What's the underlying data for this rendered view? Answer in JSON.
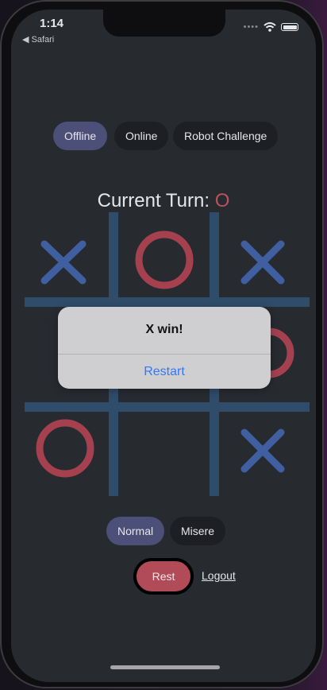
{
  "status_bar": {
    "time": "1:14",
    "back_label": "◀ Safari"
  },
  "mode_tabs": [
    {
      "label": "Offline",
      "active": true
    },
    {
      "label": "Online",
      "active": false
    },
    {
      "label": "Robot Challenge",
      "active": false
    }
  ],
  "turn": {
    "label": "Current Turn:",
    "mark": "O"
  },
  "board": {
    "cells": [
      "X",
      "O",
      "X",
      "",
      "",
      "O",
      "O",
      "",
      "X"
    ]
  },
  "variant_tabs": [
    {
      "label": "Normal",
      "active": true
    },
    {
      "label": "Misere",
      "active": false
    }
  ],
  "alert": {
    "title": "X win!",
    "button": "Restart"
  },
  "actions": {
    "rest": "Rest",
    "logout": "Logout"
  },
  "colors": {
    "x": "#3f5fa0",
    "o": "#a5414f",
    "grid": "#2f4c6a",
    "accent_pill": "#4c4f77",
    "link": "#3478f6"
  }
}
